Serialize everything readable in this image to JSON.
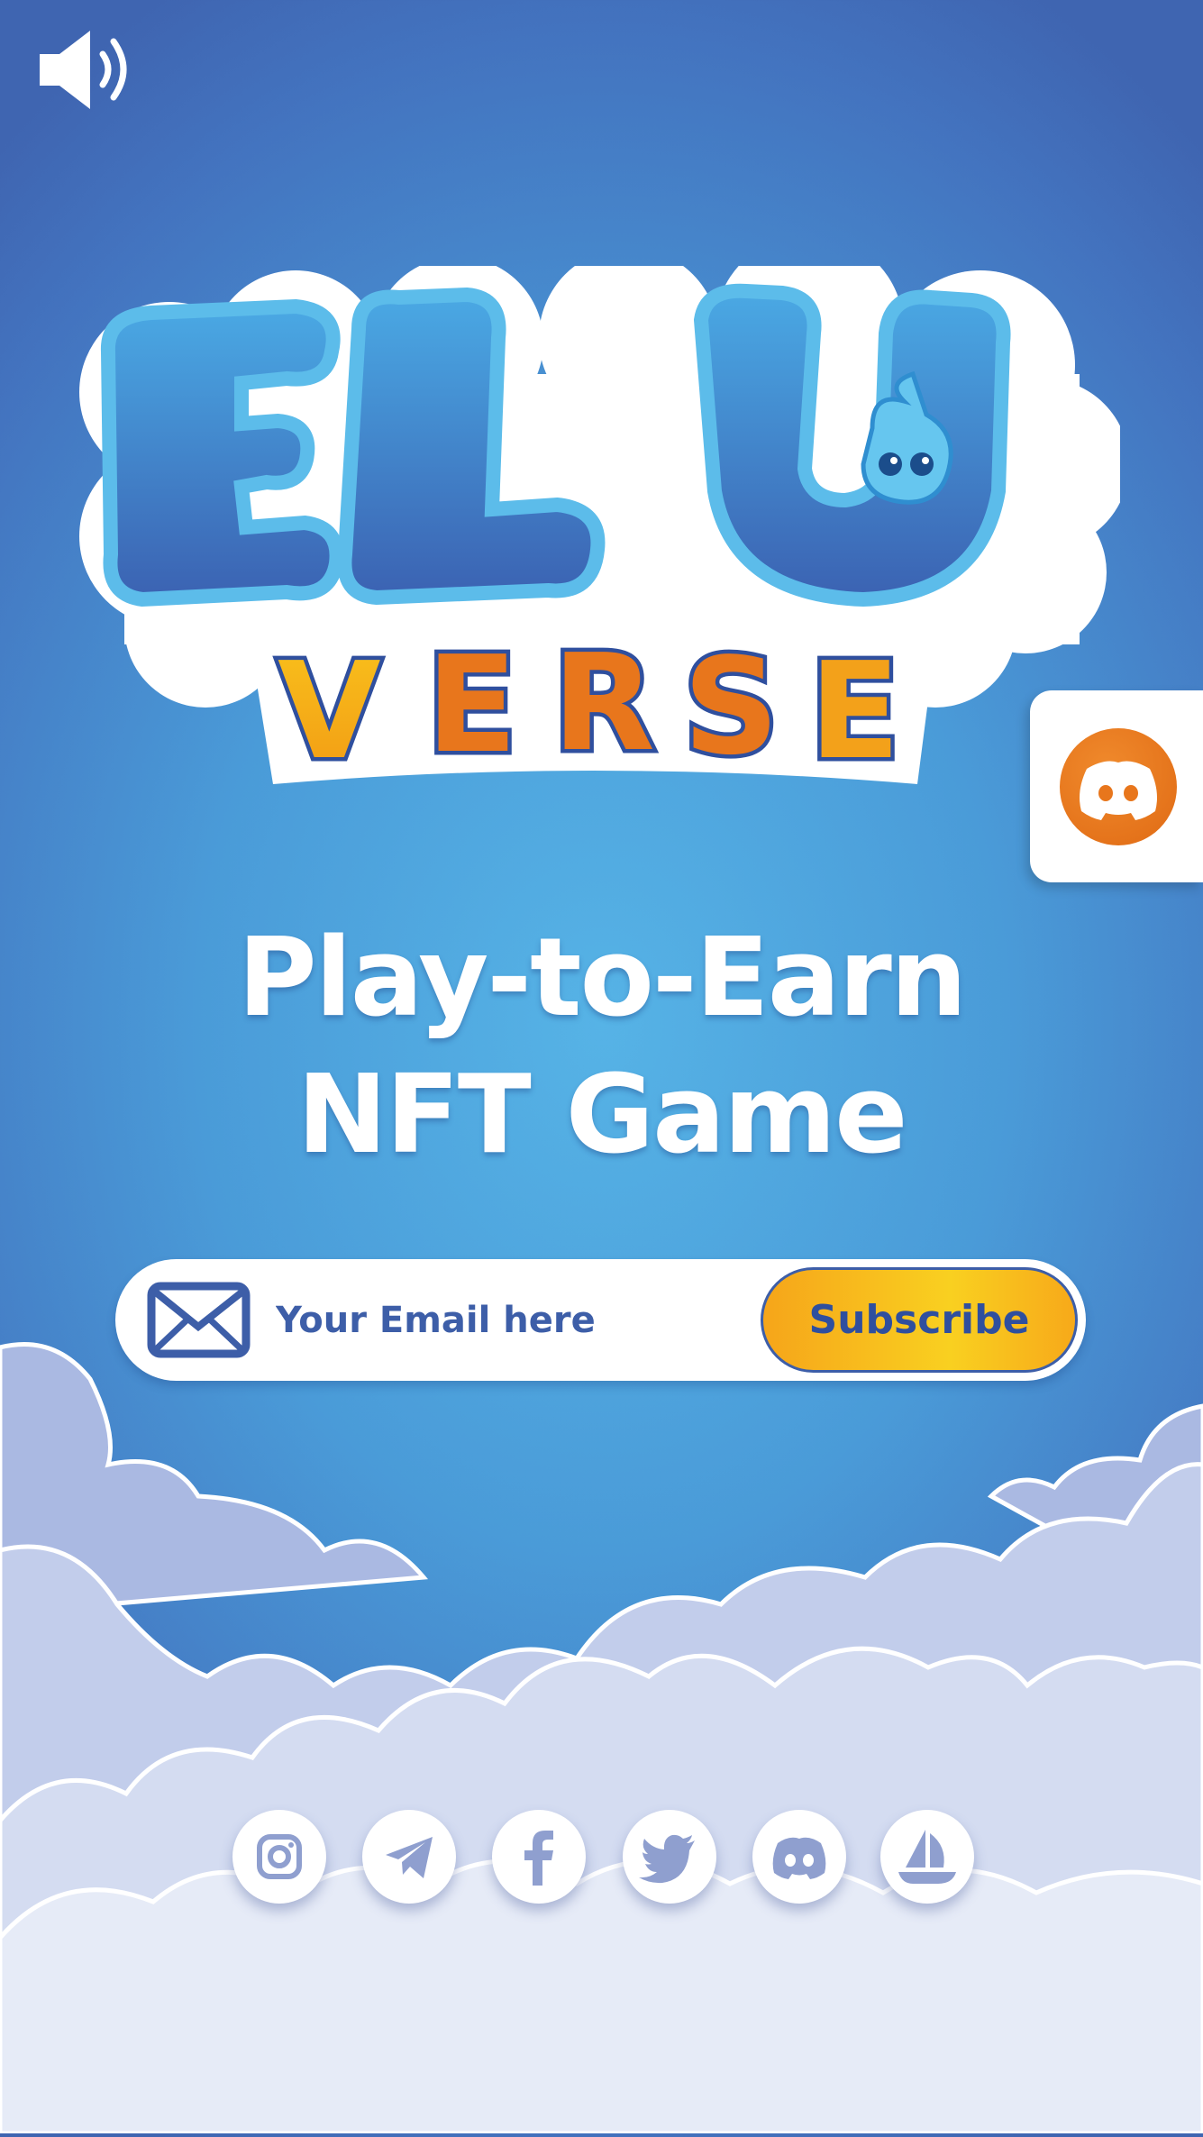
{
  "header": {
    "sound_icon": "speaker-volume-icon"
  },
  "logo": {
    "line1": "ELU",
    "line2": "VERSE"
  },
  "side_tab": {
    "icon": "discord-icon",
    "color": "#e8761c"
  },
  "hero": {
    "line1": "Play-to-Earn",
    "line2": "NFT Game"
  },
  "subscribe_form": {
    "icon": "mail-icon",
    "placeholder": "Your Email here",
    "button_label": "Subscribe",
    "button_color": "#f9c31f"
  },
  "social": [
    {
      "name": "instagram-icon"
    },
    {
      "name": "telegram-icon"
    },
    {
      "name": "facebook-icon"
    },
    {
      "name": "twitter-icon"
    },
    {
      "name": "discord-icon"
    },
    {
      "name": "opensea-icon"
    }
  ],
  "colors": {
    "sky_top": "#3f65b1",
    "sky_center": "#56b3e6",
    "brand_blue": "#3d5ea8",
    "orange": "#e8761c"
  }
}
